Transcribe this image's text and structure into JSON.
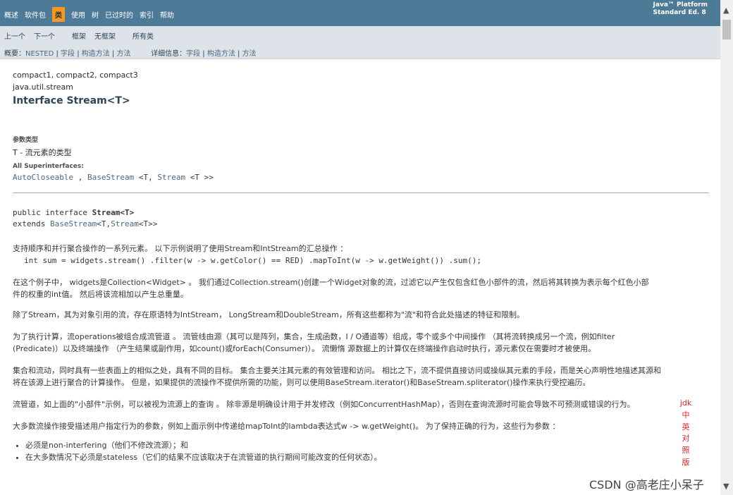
{
  "topnav": {
    "items": [
      "概述",
      "软件包",
      "类",
      "使用",
      "树",
      "已过时的",
      "索引",
      "帮助"
    ],
    "active_index": 2,
    "platform_line1": "Java™ Platform",
    "platform_line2": "Standard Ed. 8"
  },
  "subnav": {
    "prev": "上一个",
    "next": "下一个",
    "frames": "框架",
    "noframes": "无框架",
    "allclasses": "所有类",
    "summary_prefix": "概要：",
    "summary_links": [
      "NESTED",
      "字段",
      "构造方法",
      "方法"
    ],
    "detail_prefix": "详细信息：",
    "detail_links": [
      "字段",
      "构造方法",
      "方法"
    ]
  },
  "header": {
    "profiles": "compact1, compact2, compact3",
    "package": "java.util.stream",
    "title": "Interface Stream<T>"
  },
  "typeparams": {
    "label": "参数类型",
    "value": "T - 流元素的类型"
  },
  "superinterfaces": {
    "label": "All Superinterfaces:",
    "items": [
      {
        "name": "AutoCloseable",
        "suffix": " , "
      },
      {
        "name": "BaseStream",
        "suffix": " <T,  "
      },
      {
        "name": "Stream",
        "suffix": " <T >>"
      }
    ]
  },
  "declaration": {
    "line1_prefix": "public interface ",
    "line1_name": "Stream",
    "line1_suffix": "<T>",
    "line2_prefix": "extends ",
    "line2_base": "BaseStream",
    "line2_mid": "<T,",
    "line2_stream": "Stream",
    "line2_suffix": "<T>>"
  },
  "paragraphs": [
    {
      "id": "p1",
      "line1": "支持顺序和并行聚合操作的一系列元素。 以下示例说明了使用Stream和IntStream的汇总操作 ：",
      "line2": "int sum = widgets.stream() .filter(w -> w.getColor() == RED) .mapToInt(w -> w.getWeight()) .sum();"
    },
    {
      "id": "p2",
      "line1": "在这个例子中， widgets是Collection<Widget> 。 我们通过Collection.stream()创建一个Widget对象的流，过滤它以产生仅包含红色小部件的流，然后将其转换为表示每个红色小部",
      "line2": "件的权重的int值。 然后将该流相加以产生总重量。"
    },
    {
      "id": "p3",
      "line1": "除了Stream，其为对象引用的流，存在原语特为IntStream， LongStream和DoubleStream，所有这些都称为\"流\"和符合此处描述的特征和限制。",
      "line2": ""
    },
    {
      "id": "p4",
      "line1": "为了执行计算，流operations被组合成流管道 。 流管线由源（其可以是阵列，集合，生成函数，I / O通道等）组成，零个或多个中间操作 （其将流转换成另一个流，例如filter",
      "line2": "(Predicate)）以及终端操作 （产生结果或副作用，如count()或forEach(Consumer)）。 流懒惰 源数据上的计算仅在终端操作启动时执行，源元素仅在需要时才被使用。"
    },
    {
      "id": "p5",
      "line1": "集合和流动，同时具有一些表面上的相似之处，具有不同的目标。 集合主要关注其元素的有效管理和访问。 相比之下，流不提供直接访问或操纵其元素的手段，而是关心声明性地描述其源和",
      "line2": "将在该源上进行聚合的计算操作。 但是，如果提供的流操作不提供所需的功能，则可以使用BaseStream.iterator()和BaseStream.spliterator()操作来执行受控遍历。"
    },
    {
      "id": "p6",
      "line1": "流管道，如上面的\"小部件\"示例，可以被视为流源上的查询 。 除非源是明确设计用于并发修改（例如ConcurrentHashMap），否则在查询流源时可能会导致不可预测或错误的行为。",
      "line2": ""
    },
    {
      "id": "p7",
      "line1": "大多数流操作接受描述用户指定行为的参数，例如上面示例中传递给mapToInt的lambda表达式w -> w.getWeight()。 为了保持正确的行为，这些行为参数 ：",
      "line2": ""
    }
  ],
  "bullets": [
    "必须是non-interfering（他们不修改流源）；和",
    "在大多数情况下必须是stateless（它们的结果不应该取决于在流管道的执行期间可能改变的任何状态）。"
  ],
  "overlay": {
    "red_label": [
      "jdk",
      "中",
      "英",
      "对",
      "照",
      "版"
    ],
    "watermark": "CSDN @高老庄小呆子"
  },
  "colors": {
    "topnav_bg": "#4d7a97",
    "active_tab": "#f8981d",
    "subnav_bg": "#dee3e9",
    "link": "#4a6782",
    "red_label": "#e02020"
  }
}
